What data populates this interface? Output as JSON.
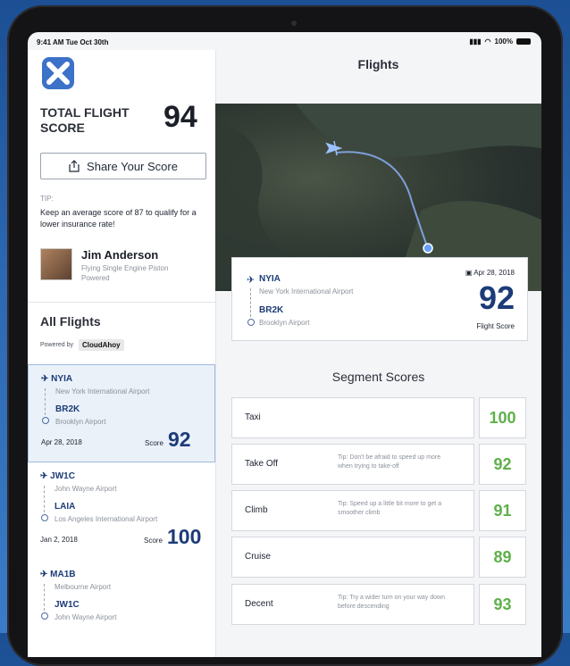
{
  "status_bar": {
    "time": "9:41 AM  Tue Oct 30th",
    "battery": "100%"
  },
  "header": {
    "title": "Flights"
  },
  "colors": {
    "accent": "#1c3b78",
    "score_green": "#5fb04a",
    "page_bg": "#f4f5f7"
  },
  "summary": {
    "score_label": "TOTAL FLIGHT SCORE",
    "score_value": "94",
    "share_label": "Share Your Score",
    "tip_heading": "TIP:",
    "tip_text": "Keep an average score of 87 to qualify for a lower insurance rate!"
  },
  "pilot": {
    "name": "Jim Anderson",
    "subtitle": "Flying Single Engine Piston Powered"
  },
  "all_flights": {
    "heading": "All Flights",
    "powered_by": "Powered by",
    "provider": "CloudAhoy"
  },
  "flights": [
    {
      "from_code": "NYIA",
      "from_name": "New York International Airport",
      "to_code": "BR2K",
      "to_name": "Brooklyn Airport",
      "date": "Apr 28, 2018",
      "score_label": "Score",
      "score": "92"
    },
    {
      "from_code": "JW1C",
      "from_name": "John Wayne Airport",
      "to_code": "LAIA",
      "to_name": "Los Angeles International Airport",
      "date": "Jan 2, 2018",
      "score_label": "Score",
      "score": "100"
    },
    {
      "from_code": "MA1B",
      "from_name": "Melbourne Airport",
      "to_code": "JW1C",
      "to_name": "John Wayne Airport"
    }
  ],
  "flight_card": {
    "from_code": "NYIA",
    "from_name": "New York International Airport",
    "to_code": "BR2K",
    "to_name": "Brooklyn Airport",
    "date": "Apr 28, 2018",
    "score": "92",
    "score_label": "Flight Score"
  },
  "segments": {
    "heading": "Segment Scores",
    "rows": [
      {
        "name": "Taxi",
        "tip": "",
        "score": "100"
      },
      {
        "name": "Take Off",
        "tip": "Tip: Don't be afraid to speed up more when trying to take-off",
        "score": "92"
      },
      {
        "name": "Climb",
        "tip": "Tip: Speed up a little bit more to get a smoother climb",
        "score": "91"
      },
      {
        "name": "Cruise",
        "tip": "",
        "score": "89"
      },
      {
        "name": "Decent",
        "tip": "Tip: Try a wider turn on your way down before descending",
        "score": "93"
      }
    ]
  }
}
